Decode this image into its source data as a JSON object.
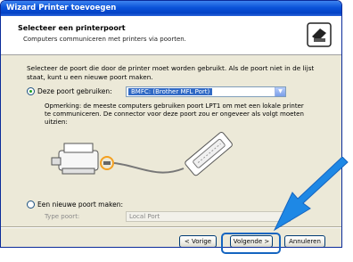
{
  "window": {
    "title": "Wizard Printer toevoegen"
  },
  "header": {
    "title": "Selecteer een printerpoort",
    "subtitle": "Computers communiceren met printers via poorten."
  },
  "body": {
    "description": "Selecteer de poort die door de printer moet worden gebruikt. Als de poort niet in de lijst staat, kunt u een nieuwe poort maken.",
    "use_port_label": "Deze poort gebruiken:",
    "use_port_value": "BMFC: (Brother MFL Port)",
    "note": "Opmerking: de meeste computers gebruiken poort LPT1 om met een lokale printer te communiceren. De connector voor deze poort zou er ongeveer als volgt moeten uitzien:",
    "new_port_label": "Een nieuwe poort maken:",
    "port_type_label": "Type poort:",
    "port_type_value": "Local Port"
  },
  "buttons": {
    "back": "< Vorige",
    "next": "Volgende >",
    "cancel": "Annuleren"
  },
  "colors": {
    "title_bar": "#0a52d8",
    "highlight": "#1565c0",
    "arrow": "#1e88e5"
  },
  "state": {
    "selected_option": "use_existing_port"
  }
}
